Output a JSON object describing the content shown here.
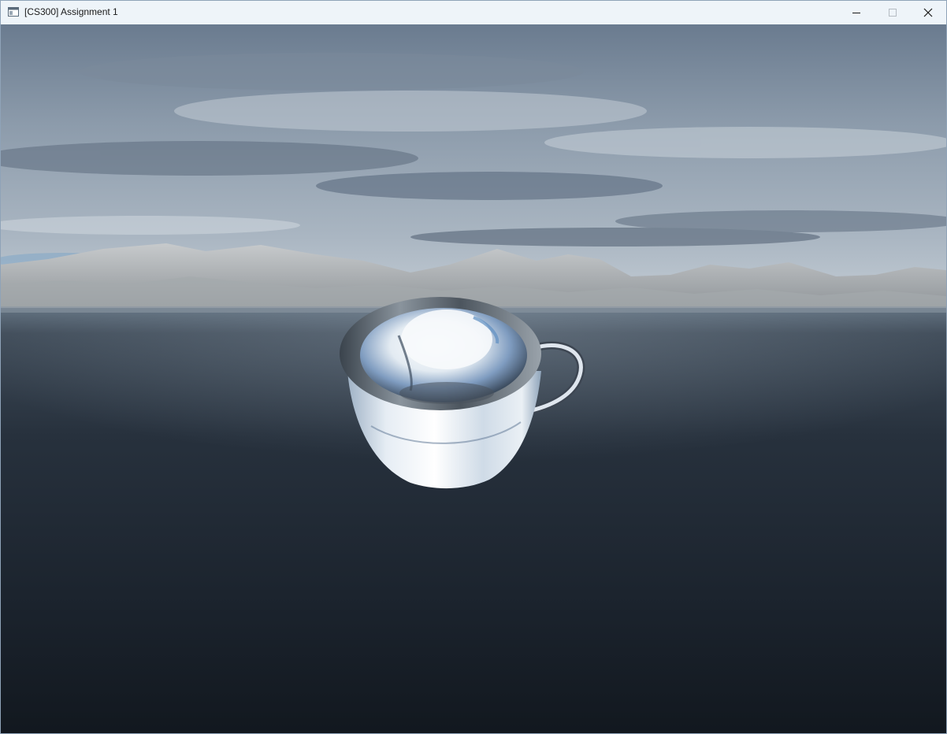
{
  "window": {
    "title": "[CS300] Assignment 1"
  },
  "scene": {
    "icons": {
      "app": "app-window-icon",
      "minimize": "minimize-icon",
      "maximize": "maximize-icon",
      "close": "close-icon"
    },
    "colors": {
      "sky_top": "#6f8094",
      "sky_mid": "#b4bfc9",
      "mountains": "#b9bcbe",
      "water": "#1c2530",
      "cup": "#e8eef4"
    }
  }
}
